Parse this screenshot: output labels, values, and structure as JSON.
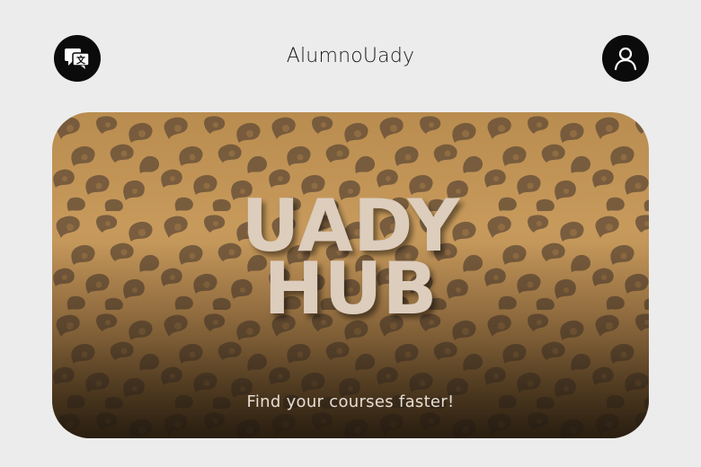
{
  "header": {
    "title": "AlumnoUady",
    "language_button_icon": "translate-icon",
    "profile_button_icon": "user-icon"
  },
  "hero": {
    "title_line1": "UADY",
    "title_line2": "HUB",
    "subtitle": "Find your courses faster!",
    "pattern": "leopard-print",
    "colors": {
      "background": "#c79a5c",
      "spots": "#6b5238",
      "title": "#dccdbd"
    }
  },
  "colors": {
    "page_background": "#ececec",
    "button_background": "#0b0b0b"
  }
}
